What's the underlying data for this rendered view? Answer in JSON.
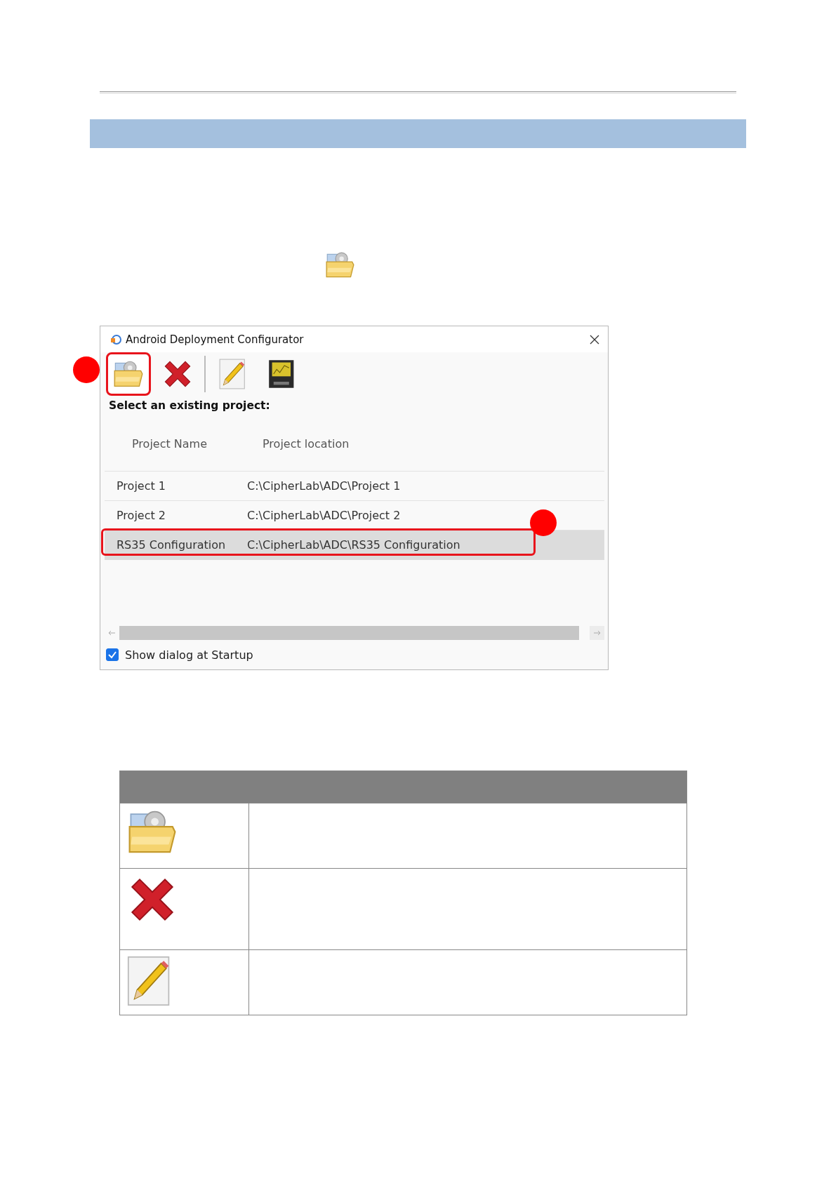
{
  "dialog": {
    "title": "Android Deployment Configurator",
    "toolbar": [
      {
        "kind": "open",
        "highlighted": true
      },
      {
        "kind": "delete",
        "highlighted": false
      },
      {
        "kind": "separator"
      },
      {
        "kind": "edit",
        "highlighted": false
      },
      {
        "kind": "save",
        "highlighted": false
      }
    ],
    "prompt": "Select an existing project:",
    "table": {
      "columns": [
        "Project Name",
        "Project location"
      ],
      "rows": [
        {
          "name": "Project 1",
          "location": "C:\\CipherLab\\ADC\\Project 1",
          "selected": false
        },
        {
          "name": "Project 2",
          "location": "C:\\CipherLab\\ADC\\Project 2",
          "selected": false
        },
        {
          "name": "RS35 Configuration",
          "location": "C:\\CipherLab\\ADC\\RS35 Configuration",
          "selected": true
        }
      ]
    },
    "startup_checkbox": {
      "label": "Show dialog at Startup",
      "checked": true
    }
  },
  "icon_table": {
    "rows": [
      {
        "kind": "open"
      },
      {
        "kind": "delete"
      },
      {
        "kind": "edit"
      }
    ]
  }
}
